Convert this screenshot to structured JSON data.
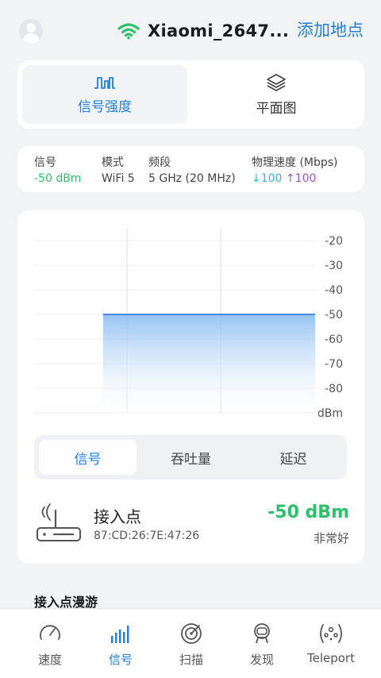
{
  "header": {
    "ssid": "Xiaomi_2647...",
    "add_place": "添加地点",
    "wifi_color": "#2bc26b"
  },
  "view_tabs": [
    {
      "label": "信号强度",
      "icon": "signal-wave-icon",
      "active": true
    },
    {
      "label": "平面图",
      "icon": "layers-icon",
      "active": false
    }
  ],
  "info": {
    "signal_label": "信号",
    "signal_value": "-50 dBm",
    "mode_label": "模式",
    "mode_value": "WiFi 5",
    "band_label": "频段",
    "band_value": "5 GHz (20 MHz)",
    "phy_label": "物理速度 (Mbps)",
    "phy_down": "100",
    "phy_up": "100"
  },
  "chart_data": {
    "type": "area",
    "y_ticks": [
      "-20",
      "-30",
      "-40",
      "-50",
      "-60",
      "-70",
      "-80"
    ],
    "yunit": "dBm",
    "ylim": [
      -90,
      -20
    ],
    "values": [
      -50
    ],
    "grid": true
  },
  "segment": {
    "items": [
      "信号",
      "吞吐量",
      "延迟"
    ],
    "active_index": 0
  },
  "access_point": {
    "title": "接入点",
    "mac": "87:CD:26:7E:47:26",
    "dbm": "-50 dBm",
    "quality": "非常好"
  },
  "roaming": {
    "title": "接入点漫游"
  },
  "bottom_nav": [
    {
      "label": "速度",
      "icon": "speedometer-icon"
    },
    {
      "label": "信号",
      "icon": "signal-bars-icon",
      "active": true
    },
    {
      "label": "扫描",
      "icon": "radar-icon"
    },
    {
      "label": "发现",
      "icon": "astronaut-icon"
    },
    {
      "label": "Teleport",
      "icon": "teleport-icon"
    }
  ],
  "colors": {
    "accent": "#1e7fe0",
    "good": "#2bc26b",
    "download": "#33b6e6",
    "upload": "#a550d6"
  }
}
